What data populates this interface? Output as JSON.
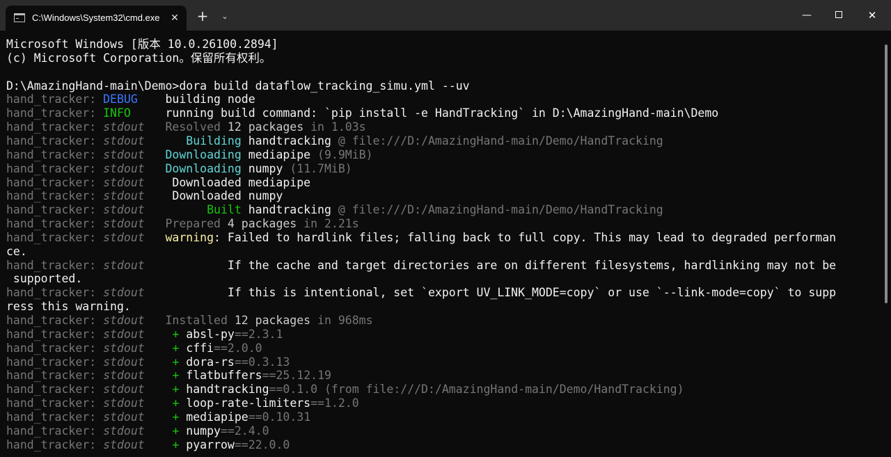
{
  "window": {
    "tab_title": "C:\\Windows\\System32\\cmd.exe",
    "tab_close": "✕",
    "new_tab": "+",
    "dropdown": "⌄",
    "minimize": "—",
    "close": "✕"
  },
  "terminal": {
    "lines": [
      [
        {
          "t": "Microsoft Windows [版本 10.0.26100.2894]",
          "c": "c-white"
        }
      ],
      [
        {
          "t": "(c) Microsoft Corporation。保留所有权利。",
          "c": "c-white"
        }
      ],
      [],
      [
        {
          "t": "D:\\AmazingHand-main\\Demo>dora build dataflow_tracking_simu.yml --uv",
          "c": "c-white"
        }
      ],
      [
        {
          "t": "hand_tracker: ",
          "c": "c-gray"
        },
        {
          "t": "DEBUG",
          "c": "c-blue"
        },
        {
          "t": "    building node",
          "c": "c-white"
        }
      ],
      [
        {
          "t": "hand_tracker: ",
          "c": "c-gray"
        },
        {
          "t": "INFO",
          "c": "c-green"
        },
        {
          "t": "     running build command: `pip install -e HandTracking` in D:\\AmazingHand-main\\Demo",
          "c": "c-white"
        }
      ],
      [
        {
          "t": "hand_tracker: ",
          "c": "c-gray"
        },
        {
          "t": "stdout",
          "c": "c-gray italic"
        },
        {
          "t": "   Resolved ",
          "c": "c-gray"
        },
        {
          "t": "12 packages",
          "c": "c-light"
        },
        {
          "t": " in 1.03s",
          "c": "c-gray"
        }
      ],
      [
        {
          "t": "hand_tracker: ",
          "c": "c-gray"
        },
        {
          "t": "stdout",
          "c": "c-gray italic"
        },
        {
          "t": "      ",
          "c": "c-gray"
        },
        {
          "t": "Building",
          "c": "c-cyan"
        },
        {
          "t": " handtracking",
          "c": "c-white"
        },
        {
          "t": " @ file:///D:/AmazingHand-main/Demo/HandTracking",
          "c": "c-gray"
        }
      ],
      [
        {
          "t": "hand_tracker: ",
          "c": "c-gray"
        },
        {
          "t": "stdout",
          "c": "c-gray italic"
        },
        {
          "t": "   ",
          "c": "c-gray"
        },
        {
          "t": "Downloading",
          "c": "c-cyan"
        },
        {
          "t": " mediapipe",
          "c": "c-white"
        },
        {
          "t": " (9.9MiB)",
          "c": "c-gray"
        }
      ],
      [
        {
          "t": "hand_tracker: ",
          "c": "c-gray"
        },
        {
          "t": "stdout",
          "c": "c-gray italic"
        },
        {
          "t": "   ",
          "c": "c-gray"
        },
        {
          "t": "Downloading",
          "c": "c-cyan"
        },
        {
          "t": " numpy",
          "c": "c-white"
        },
        {
          "t": " (11.7MiB)",
          "c": "c-gray"
        }
      ],
      [
        {
          "t": "hand_tracker: ",
          "c": "c-gray"
        },
        {
          "t": "stdout",
          "c": "c-gray italic"
        },
        {
          "t": "    Downloaded mediapipe",
          "c": "c-white"
        }
      ],
      [
        {
          "t": "hand_tracker: ",
          "c": "c-gray"
        },
        {
          "t": "stdout",
          "c": "c-gray italic"
        },
        {
          "t": "    Downloaded numpy",
          "c": "c-white"
        }
      ],
      [
        {
          "t": "hand_tracker: ",
          "c": "c-gray"
        },
        {
          "t": "stdout",
          "c": "c-gray italic"
        },
        {
          "t": "         ",
          "c": "c-gray"
        },
        {
          "t": "Built",
          "c": "c-green"
        },
        {
          "t": " handtracking",
          "c": "c-white"
        },
        {
          "t": " @ file:///D:/AmazingHand-main/Demo/HandTracking",
          "c": "c-gray"
        }
      ],
      [
        {
          "t": "hand_tracker: ",
          "c": "c-gray"
        },
        {
          "t": "stdout",
          "c": "c-gray italic"
        },
        {
          "t": "   Prepared ",
          "c": "c-gray"
        },
        {
          "t": "4 packages",
          "c": "c-light"
        },
        {
          "t": " in 2.21s",
          "c": "c-gray"
        }
      ],
      [
        {
          "t": "hand_tracker: ",
          "c": "c-gray"
        },
        {
          "t": "stdout",
          "c": "c-gray italic"
        },
        {
          "t": "   ",
          "c": "c-gray"
        },
        {
          "t": "warning",
          "c": "c-yellow"
        },
        {
          "t": ": Failed to hardlink files; falling back to full copy. This may lead to degraded performan",
          "c": "c-white"
        }
      ],
      [
        {
          "t": "ce.",
          "c": "c-white"
        }
      ],
      [
        {
          "t": "hand_tracker: ",
          "c": "c-gray"
        },
        {
          "t": "stdout",
          "c": "c-gray italic"
        },
        {
          "t": "            If the cache and target directories are on different filesystems, hardlinking may not be",
          "c": "c-white"
        }
      ],
      [
        {
          "t": " supported.",
          "c": "c-white"
        }
      ],
      [
        {
          "t": "hand_tracker: ",
          "c": "c-gray"
        },
        {
          "t": "stdout",
          "c": "c-gray italic"
        },
        {
          "t": "            If this is intentional, set `export UV_LINK_MODE=copy` or use `--link-mode=copy` to supp",
          "c": "c-white"
        }
      ],
      [
        {
          "t": "ress this warning.",
          "c": "c-white"
        }
      ],
      [
        {
          "t": "hand_tracker: ",
          "c": "c-gray"
        },
        {
          "t": "stdout",
          "c": "c-gray italic"
        },
        {
          "t": "   Installed ",
          "c": "c-gray"
        },
        {
          "t": "12 packages",
          "c": "c-light"
        },
        {
          "t": " in 968ms",
          "c": "c-gray"
        }
      ],
      [
        {
          "t": "hand_tracker: ",
          "c": "c-gray"
        },
        {
          "t": "stdout",
          "c": "c-gray italic"
        },
        {
          "t": "    ",
          "c": "c-gray"
        },
        {
          "t": "+",
          "c": "c-green"
        },
        {
          "t": " absl-py",
          "c": "c-white"
        },
        {
          "t": "==2.3.1",
          "c": "c-gray"
        }
      ],
      [
        {
          "t": "hand_tracker: ",
          "c": "c-gray"
        },
        {
          "t": "stdout",
          "c": "c-gray italic"
        },
        {
          "t": "    ",
          "c": "c-gray"
        },
        {
          "t": "+",
          "c": "c-green"
        },
        {
          "t": " cffi",
          "c": "c-white"
        },
        {
          "t": "==2.0.0",
          "c": "c-gray"
        }
      ],
      [
        {
          "t": "hand_tracker: ",
          "c": "c-gray"
        },
        {
          "t": "stdout",
          "c": "c-gray italic"
        },
        {
          "t": "    ",
          "c": "c-gray"
        },
        {
          "t": "+",
          "c": "c-green"
        },
        {
          "t": " dora-rs",
          "c": "c-white"
        },
        {
          "t": "==0.3.13",
          "c": "c-gray"
        }
      ],
      [
        {
          "t": "hand_tracker: ",
          "c": "c-gray"
        },
        {
          "t": "stdout",
          "c": "c-gray italic"
        },
        {
          "t": "    ",
          "c": "c-gray"
        },
        {
          "t": "+",
          "c": "c-green"
        },
        {
          "t": " flatbuffers",
          "c": "c-white"
        },
        {
          "t": "==25.12.19",
          "c": "c-gray"
        }
      ],
      [
        {
          "t": "hand_tracker: ",
          "c": "c-gray"
        },
        {
          "t": "stdout",
          "c": "c-gray italic"
        },
        {
          "t": "    ",
          "c": "c-gray"
        },
        {
          "t": "+",
          "c": "c-green"
        },
        {
          "t": " handtracking",
          "c": "c-white"
        },
        {
          "t": "==0.1.0 (from file:///D:/AmazingHand-main/Demo/HandTracking)",
          "c": "c-gray"
        }
      ],
      [
        {
          "t": "hand_tracker: ",
          "c": "c-gray"
        },
        {
          "t": "stdout",
          "c": "c-gray italic"
        },
        {
          "t": "    ",
          "c": "c-gray"
        },
        {
          "t": "+",
          "c": "c-green"
        },
        {
          "t": " loop-rate-limiters",
          "c": "c-white"
        },
        {
          "t": "==1.2.0",
          "c": "c-gray"
        }
      ],
      [
        {
          "t": "hand_tracker: ",
          "c": "c-gray"
        },
        {
          "t": "stdout",
          "c": "c-gray italic"
        },
        {
          "t": "    ",
          "c": "c-gray"
        },
        {
          "t": "+",
          "c": "c-green"
        },
        {
          "t": " mediapipe",
          "c": "c-white"
        },
        {
          "t": "==0.10.31",
          "c": "c-gray"
        }
      ],
      [
        {
          "t": "hand_tracker: ",
          "c": "c-gray"
        },
        {
          "t": "stdout",
          "c": "c-gray italic"
        },
        {
          "t": "    ",
          "c": "c-gray"
        },
        {
          "t": "+",
          "c": "c-green"
        },
        {
          "t": " numpy",
          "c": "c-white"
        },
        {
          "t": "==2.4.0",
          "c": "c-gray"
        }
      ],
      [
        {
          "t": "hand_tracker: ",
          "c": "c-gray"
        },
        {
          "t": "stdout",
          "c": "c-gray italic"
        },
        {
          "t": "    ",
          "c": "c-gray"
        },
        {
          "t": "+",
          "c": "c-green"
        },
        {
          "t": " pyarrow",
          "c": "c-white"
        },
        {
          "t": "==22.0.0",
          "c": "c-gray"
        }
      ]
    ]
  }
}
